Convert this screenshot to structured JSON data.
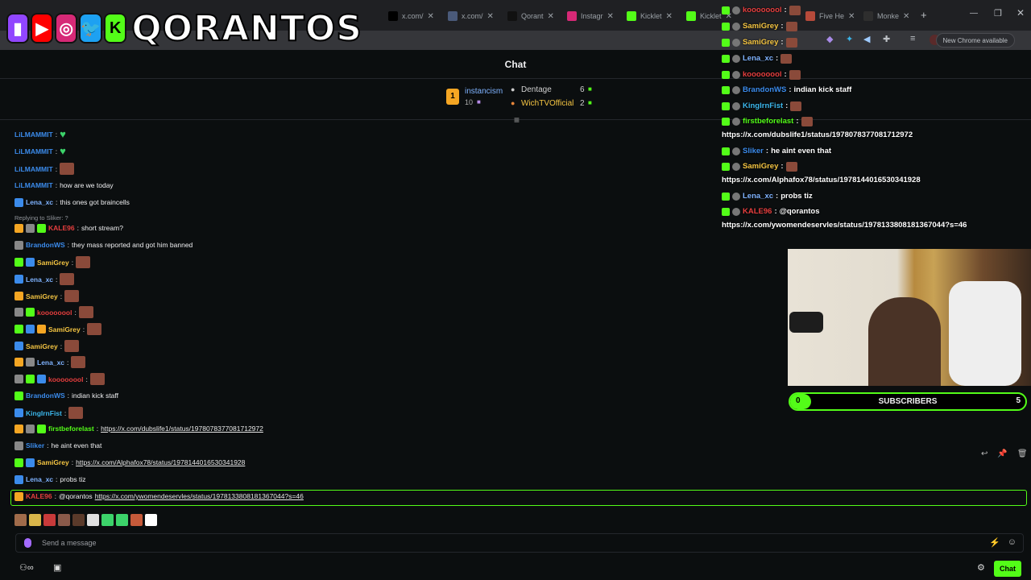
{
  "browser": {
    "tabs": [
      {
        "label": "x.com/",
        "color": "#000000"
      },
      {
        "label": "x.com/",
        "color": "#4a5a7a"
      },
      {
        "label": "Qorant",
        "color": "#111111"
      },
      {
        "label": "Instagr",
        "color": "#d62976"
      },
      {
        "label": "Kicklet",
        "color": "#53fc18"
      },
      {
        "label": "Kicklet",
        "color": "#53fc18"
      },
      {
        "label": "Five He",
        "color": "#b64a3a"
      },
      {
        "label": "Monke",
        "color": "#2e2e2e"
      }
    ],
    "new_tab": "+",
    "update_notice": "New Chrome available"
  },
  "logo": {
    "text": "QORANTOS",
    "icons": [
      "twitch-icon",
      "youtube-icon",
      "instagram-icon",
      "twitter-icon",
      "kick-icon"
    ]
  },
  "chat": {
    "header_title": "Chat",
    "leaderboard": {
      "rank": "1",
      "first": {
        "name": "instancism",
        "count": "10"
      },
      "entries": [
        {
          "name": "Dentage",
          "count": "6"
        },
        {
          "name": "WichTVOfficial",
          "count": "2"
        }
      ]
    },
    "messages": [
      {
        "user": "LiLMAMMIT",
        "color": "#3b8beb",
        "text": "",
        "kind": "heart"
      },
      {
        "user": "LiLMAMMIT",
        "color": "#3b8beb",
        "text": "",
        "kind": "heart"
      },
      {
        "user": "LiLMAMMIT",
        "color": "#3b8beb",
        "text": "",
        "kind": "emote"
      },
      {
        "user": "LiLMAMMIT",
        "color": "#3b8beb",
        "text": "how are we today"
      },
      {
        "user": "Lena_xc",
        "color": "#7fb3ff",
        "text": "this ones got braincells"
      },
      {
        "user": "KALE96",
        "color": "#e63e3e",
        "text": "short stream?"
      },
      {
        "user": "BrandonWS",
        "color": "#3b8beb",
        "text": "they mass reported and got him banned"
      },
      {
        "user": "SamiGrey",
        "color": "#f5c542",
        "text": ""
      },
      {
        "user": "Lena_xc",
        "color": "#7fb3ff",
        "text": ""
      },
      {
        "user": "SamiGrey",
        "color": "#f5c542",
        "text": ""
      },
      {
        "user": "koooooool",
        "color": "#e63e3e",
        "text": ""
      },
      {
        "user": "SamiGrey",
        "color": "#f5c542",
        "text": ""
      },
      {
        "user": "SamiGrey",
        "color": "#f5c542",
        "text": ""
      },
      {
        "user": "Lena_xc",
        "color": "#7fb3ff",
        "text": ""
      },
      {
        "user": "koooooool",
        "color": "#e63e3e",
        "text": ""
      },
      {
        "user": "BrandonWS",
        "color": "#3b8beb",
        "text": "indian kick staff"
      },
      {
        "user": "KingIrnFist",
        "color": "#3bb6eb",
        "text": ""
      },
      {
        "user": "firstbeforelast",
        "color": "#53fc18",
        "text": "https://x.com/dubslife1/status/1978078377081712972",
        "link": true
      },
      {
        "user": "Sliker",
        "color": "#3b8beb",
        "text": "he aint even that"
      },
      {
        "user": "SamiGrey",
        "color": "#f5c542",
        "text": "https://x.com/Alphafox78/status/1978144016530341928",
        "link": true
      },
      {
        "user": "Lena_xc",
        "color": "#7fb3ff",
        "text": "probs tiz"
      },
      {
        "user": "KALE96",
        "color": "#e63e3e",
        "text": "@qorantos",
        "link_text": "https://x.com/ywomendeservles/status/1978133808181367044?s=46"
      }
    ],
    "reply_note": "Replying to Sliker: ?",
    "input_placeholder": "Send a message",
    "send_label": "Chat"
  },
  "overlay_chat": [
    {
      "user": "koooooool",
      "color": "#e63e3e",
      "text": ""
    },
    {
      "user": "SamiGrey",
      "color": "#f5c542",
      "text": ""
    },
    {
      "user": "SamiGrey",
      "color": "#f5c542",
      "text": ""
    },
    {
      "user": "Lena_xc",
      "color": "#7fb3ff",
      "text": ""
    },
    {
      "user": "koooooool",
      "color": "#e63e3e",
      "text": ""
    },
    {
      "user": "BrandonWS",
      "color": "#3b8beb",
      "text": "indian kick staff"
    },
    {
      "user": "KingIrnFist",
      "color": "#3bb6eb",
      "text": ""
    },
    {
      "user": "firstbeforelast",
      "color": "#53fc18",
      "text": ""
    },
    {
      "user": "",
      "color": "#ffffff",
      "text": "https://x.com/dubslife1/status/1978078377081712972"
    },
    {
      "user": "Sliker",
      "color": "#3b8beb",
      "text": "he aint even that"
    },
    {
      "user": "SamiGrey",
      "color": "#f5c542",
      "text": ""
    },
    {
      "user": "",
      "color": "#ffffff",
      "text": "https://x.com/Alphafox78/status/1978144016530341928"
    },
    {
      "user": "Lena_xc",
      "color": "#7fb3ff",
      "text": "probs tiz"
    },
    {
      "user": "KALE96",
      "color": "#e63e3e",
      "text": "@qorantos"
    },
    {
      "user": "",
      "color": "#ffffff",
      "text": "https://x.com/ywomendeservles/status/1978133808181367044?s=46"
    }
  ],
  "sub_goal": {
    "label": "SUBSCRIBERS",
    "current": "0",
    "target": "5",
    "progress": 0.04
  },
  "colors": {
    "kick_green": "#53fc18",
    "bg": "#0b0e0f"
  }
}
